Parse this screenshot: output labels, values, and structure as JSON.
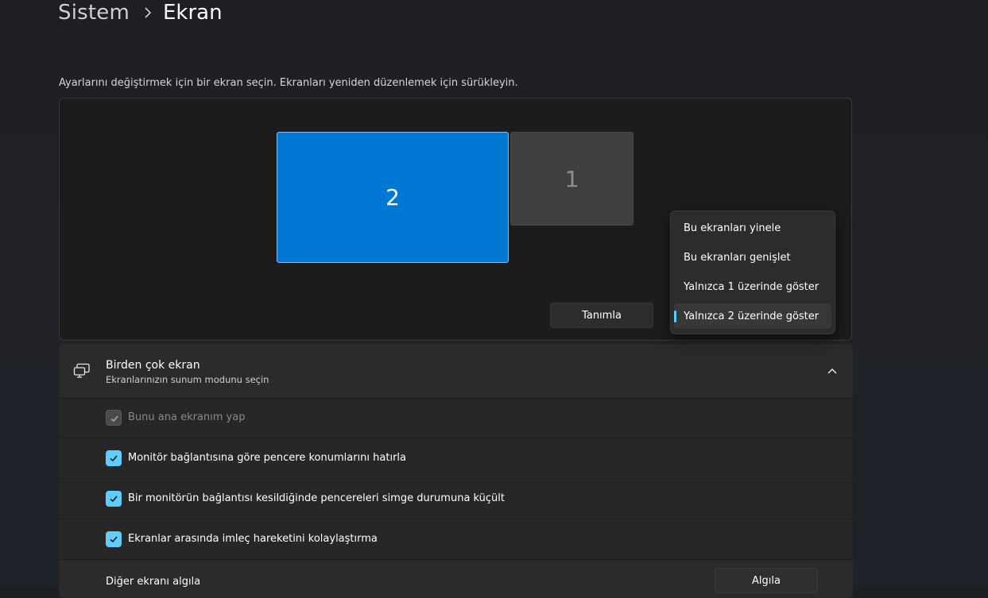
{
  "breadcrumb": {
    "parent": "Sistem",
    "current": "Ekran"
  },
  "arrangement": {
    "hint": "Ayarlarını değiştirmek için bir ekran seçin. Ekranları yeniden düzenlemek için sürükleyin.",
    "monitors": [
      {
        "label": "2",
        "selected": true
      },
      {
        "label": "1",
        "selected": false
      }
    ],
    "identify_label": "Tanımla"
  },
  "display_mode_menu": {
    "items": [
      {
        "label": "Bu ekranları yinele",
        "selected": false
      },
      {
        "label": "Bu ekranları genişlet",
        "selected": false
      },
      {
        "label": "Yalnızca 1 üzerinde göster",
        "selected": false
      },
      {
        "label": "Yalnızca 2 üzerinde göster",
        "selected": true
      }
    ]
  },
  "multiple_displays": {
    "title": "Birden çok ekran",
    "subtitle": "Ekranlarınızın sunum modunu seçin",
    "icon": "multiple-displays-icon",
    "options": [
      {
        "label": "Bunu ana ekranım yap",
        "checked": true,
        "disabled": true
      },
      {
        "label": "Monitör bağlantısına göre pencere konumlarını hatırla",
        "checked": true,
        "disabled": false
      },
      {
        "label": "Bir monitörün bağlantısı kesildiğinde pencereleri simge durumuna küçült",
        "checked": true,
        "disabled": false
      },
      {
        "label": "Ekranlar arasında imleç hareketini kolaylaştırma",
        "checked": true,
        "disabled": false
      }
    ],
    "detect": {
      "label": "Diğer ekranı algıla",
      "button": "Algıla"
    }
  },
  "colors": {
    "accent": "#60cdff",
    "selected_monitor": "#0078d4"
  }
}
